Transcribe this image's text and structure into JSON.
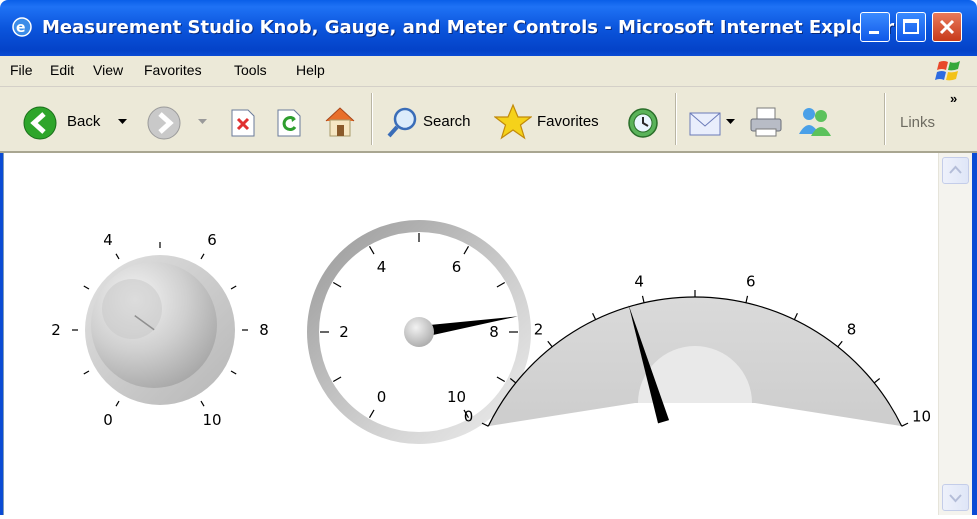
{
  "window": {
    "title": "Measurement Studio Knob, Gauge, and Meter Controls - Microsoft Internet Explorer"
  },
  "menu": [
    "File",
    "Edit",
    "View",
    "Favorites",
    "Tools",
    "Help"
  ],
  "toolbar": {
    "back_label": "Back",
    "search_label": "Search",
    "favorites_label": "Favorites",
    "links_label": "Links",
    "chevron": "»"
  },
  "controls": {
    "knob": {
      "ticks": [
        "0",
        "2",
        "4",
        "6",
        "8",
        "10"
      ],
      "value": 3.2
    },
    "gauge": {
      "ticks": [
        "0",
        "2",
        "4",
        "6",
        "8",
        "10"
      ],
      "value": 7.7
    },
    "meter": {
      "ticks": [
        "0",
        "2",
        "4",
        "6",
        "8",
        "10"
      ],
      "value": 3.7
    }
  },
  "colors": {
    "titlebar": "#0a55dc",
    "chrome": "#ece9d8",
    "close_button": "#d4502e"
  }
}
